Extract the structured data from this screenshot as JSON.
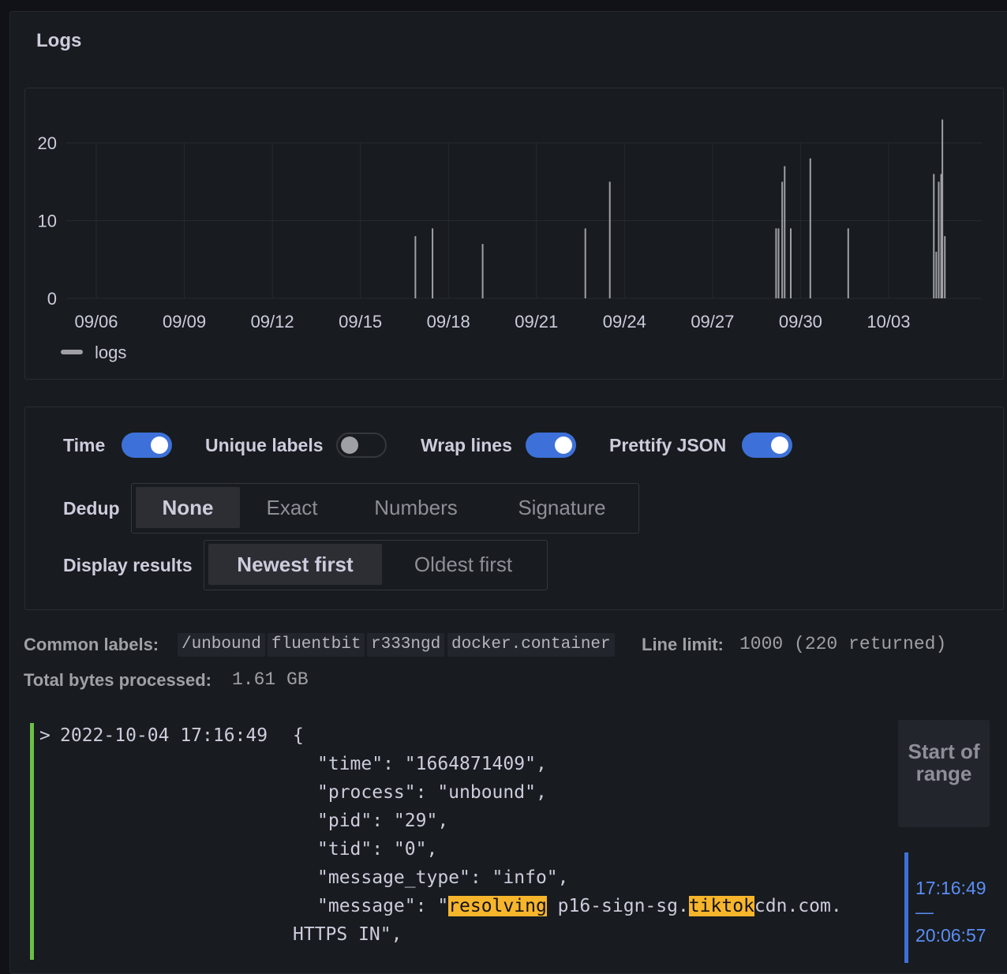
{
  "panel": {
    "title": "Logs"
  },
  "chart_data": {
    "type": "bar",
    "series": [
      {
        "name": "logs",
        "color": "#9fa0a6",
        "points": [
          {
            "x": "09/16 21:00",
            "y": 8
          },
          {
            "x": "09/17 11:00",
            "y": 9
          },
          {
            "x": "09/19 04:00",
            "y": 7
          },
          {
            "x": "09/22 16:00",
            "y": 9
          },
          {
            "x": "09/23 12:00",
            "y": 15
          },
          {
            "x": "09/29 04:00",
            "y": 9
          },
          {
            "x": "09/29 06:00",
            "y": 9
          },
          {
            "x": "09/29 09:00",
            "y": 15
          },
          {
            "x": "09/29 11:00",
            "y": 17
          },
          {
            "x": "09/29 16:00",
            "y": 9
          },
          {
            "x": "09/30 08:00",
            "y": 18
          },
          {
            "x": "10/01 15:00",
            "y": 9
          },
          {
            "x": "10/04 13:00",
            "y": 16
          },
          {
            "x": "10/04 15:00",
            "y": 6
          },
          {
            "x": "10/04 17:00",
            "y": 15
          },
          {
            "x": "10/04 19:00",
            "y": 16
          },
          {
            "x": "10/04 20:00",
            "y": 23
          },
          {
            "x": "10/04 22:00",
            "y": 8
          }
        ]
      }
    ],
    "x_ticks": [
      "09/06",
      "09/09",
      "09/12",
      "09/15",
      "09/18",
      "09/21",
      "09/24",
      "09/27",
      "09/30",
      "10/03"
    ],
    "y_ticks": [
      "0",
      "10",
      "20"
    ],
    "ylim": [
      0,
      26
    ],
    "grid": true,
    "legend_position": "bottom-left"
  },
  "options": {
    "time_label": "Time",
    "time_on": true,
    "unique_labels_label": "Unique labels",
    "unique_labels_on": false,
    "wrap_lines_label": "Wrap lines",
    "wrap_lines_on": true,
    "prettify_json_label": "Prettify JSON",
    "prettify_json_on": true,
    "dedup_label": "Dedup",
    "dedup_options": [
      "None",
      "Exact",
      "Numbers",
      "Signature"
    ],
    "dedup_selected": "None",
    "display_results_label": "Display results",
    "order_options": [
      "Newest first",
      "Oldest first"
    ],
    "order_selected": "Newest first"
  },
  "meta": {
    "common_labels_label": "Common labels:",
    "common_labels": [
      "/unbound",
      "fluentbit",
      "r333ngd",
      "docker.container"
    ],
    "line_limit_label": "Line limit:",
    "line_limit_value": "1000 (220 returned)",
    "bytes_label": "Total bytes processed:",
    "bytes_value": "1.61  GB"
  },
  "log_entry": {
    "chevron": ">",
    "timestamp": "2022-10-04 17:16:49",
    "brace": "{",
    "lines": [
      "\"time\": \"1664871409\",",
      "\"process\": \"unbound\",",
      "\"pid\": \"29\",",
      "\"tid\": \"0\",",
      "\"message_type\": \"info\","
    ],
    "message_key": "\"message\": \"",
    "message_hl1": "resolving",
    "message_mid": " p16-sign-sg.",
    "message_hl2": "tiktok",
    "message_rest": "cdn.com.",
    "message_wrap": "HTTPS IN\","
  },
  "range": {
    "start_label": "Start of range",
    "range_start": "17:16:49",
    "range_dash": "—",
    "range_end": "20:06:57"
  }
}
